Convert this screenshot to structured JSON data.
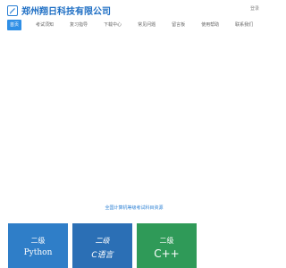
{
  "header": {
    "logo_text": "郑州翔日科技有限公司",
    "login_label": "登录"
  },
  "nav": {
    "items": [
      {
        "label": "首页",
        "active": true
      },
      {
        "label": "考试须知",
        "active": false
      },
      {
        "label": "复习指导",
        "active": false
      },
      {
        "label": "下载中心",
        "active": false
      },
      {
        "label": "常见问题",
        "active": false
      },
      {
        "label": "留言板",
        "active": false
      },
      {
        "label": "使用帮助",
        "active": false
      },
      {
        "label": "联系我们",
        "active": false
      }
    ]
  },
  "main": {
    "section_title": "全国计算机等级考试科目资源",
    "cards": [
      {
        "level": "二级",
        "subject": "Python",
        "color": "#2f7ec8"
      },
      {
        "level": "二级",
        "subject": "C语言",
        "color": "#2b6fb5"
      },
      {
        "level": "二级",
        "subject": "C++",
        "color": "#2f9a58"
      }
    ]
  },
  "colors": {
    "brand": "#1f6fc4",
    "nav_active_bg": "#2f8fe6"
  }
}
